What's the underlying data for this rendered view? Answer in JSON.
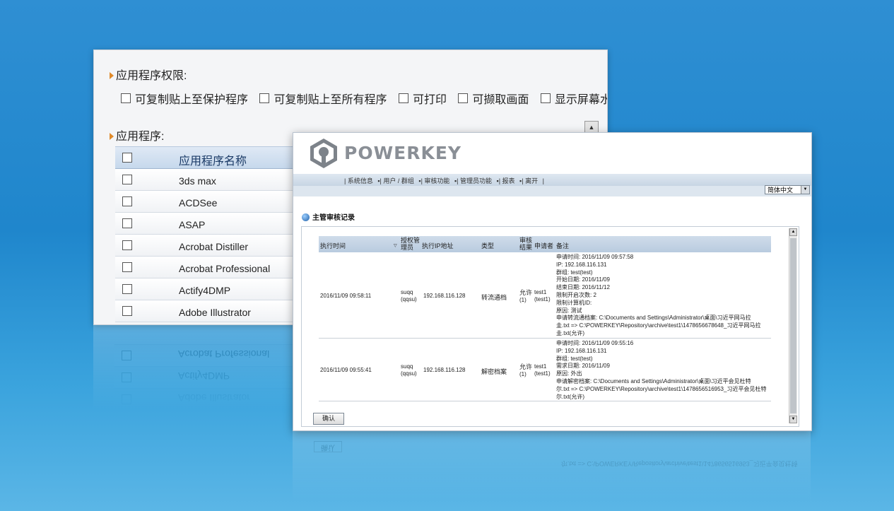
{
  "back_window": {
    "permissions_title": "应用程序权限:",
    "permissions": [
      "可复制贴上至保护程序",
      "可复制贴上至所有程序",
      "可打印",
      "可撷取画面",
      "显示屏幕水印"
    ],
    "apps_title": "应用程序:",
    "table_header": "应用程序名称",
    "apps": [
      "3ds max",
      "ACDSee",
      "ASAP",
      "Acrobat Distiller",
      "Acrobat Professional",
      "Actify4DMP",
      "Adobe Illustrator"
    ]
  },
  "front_window": {
    "brand": "POWERKEY",
    "nav": [
      "| 系统信息",
      "▪| 用户 / 群组",
      "▪| 审核功能",
      "▪| 管理员功能",
      "▪| 报表",
      "▪| 离开",
      "|"
    ],
    "language": "简体中文",
    "section_title": "主管审核记录",
    "columns": [
      "执行时间",
      "授权管理员",
      "执行IP地址",
      "类型",
      "审核结果",
      "申请者",
      "备注"
    ],
    "records": [
      {
        "time": "2016/11/09 09:58:11",
        "admin": [
          "suqq",
          "(qqsu)"
        ],
        "ip": "192.168.116.128",
        "type": "转流通档",
        "result": [
          "允许",
          "(1)"
        ],
        "applicant": [
          "test1",
          "(test1)"
        ],
        "notes": [
          "申请时间: 2016/11/09 09:57:58",
          "IP: 192.168.116.131",
          "群组: test(test)",
          "开始日期: 2016/11/09",
          "结束日期: 2016/11/12",
          "限制开启次数: 2",
          "限制计算机ID:",
          "原因: 测试",
          "申请转流通档案: C:\\Documents and Settings\\Administrator\\桌面\\习近平网马拉",
          "圭.txt => C:\\POWERKEY\\Repository\\archive\\test1\\1478656678648_习近平网马拉",
          "圭.txt(允许)"
        ]
      },
      {
        "time": "2016/11/09 09:55:41",
        "admin": [
          "suqq",
          "(qqsu)"
        ],
        "ip": "192.168.116.128",
        "type": "解密档案",
        "result": [
          "允许",
          "(1)"
        ],
        "applicant": [
          "test1",
          "(test1)"
        ],
        "notes": [
          "申请时间: 2016/11/09 09:55:16",
          "IP: 192.168.116.131",
          "群组: test(test)",
          "需求日期: 2016/11/09",
          "原因: 外出",
          "申请解密档案: C:\\Documents and Settings\\Administrator\\桌面\\习近平会见杜特",
          "尔.txt => C:\\POWERKEY\\Repository\\archive\\test1\\1478656516953_习近平会见杜特",
          "尔.txt(允许)"
        ]
      }
    ],
    "confirm_label": "确认",
    "reflection_confirm": "确认"
  }
}
